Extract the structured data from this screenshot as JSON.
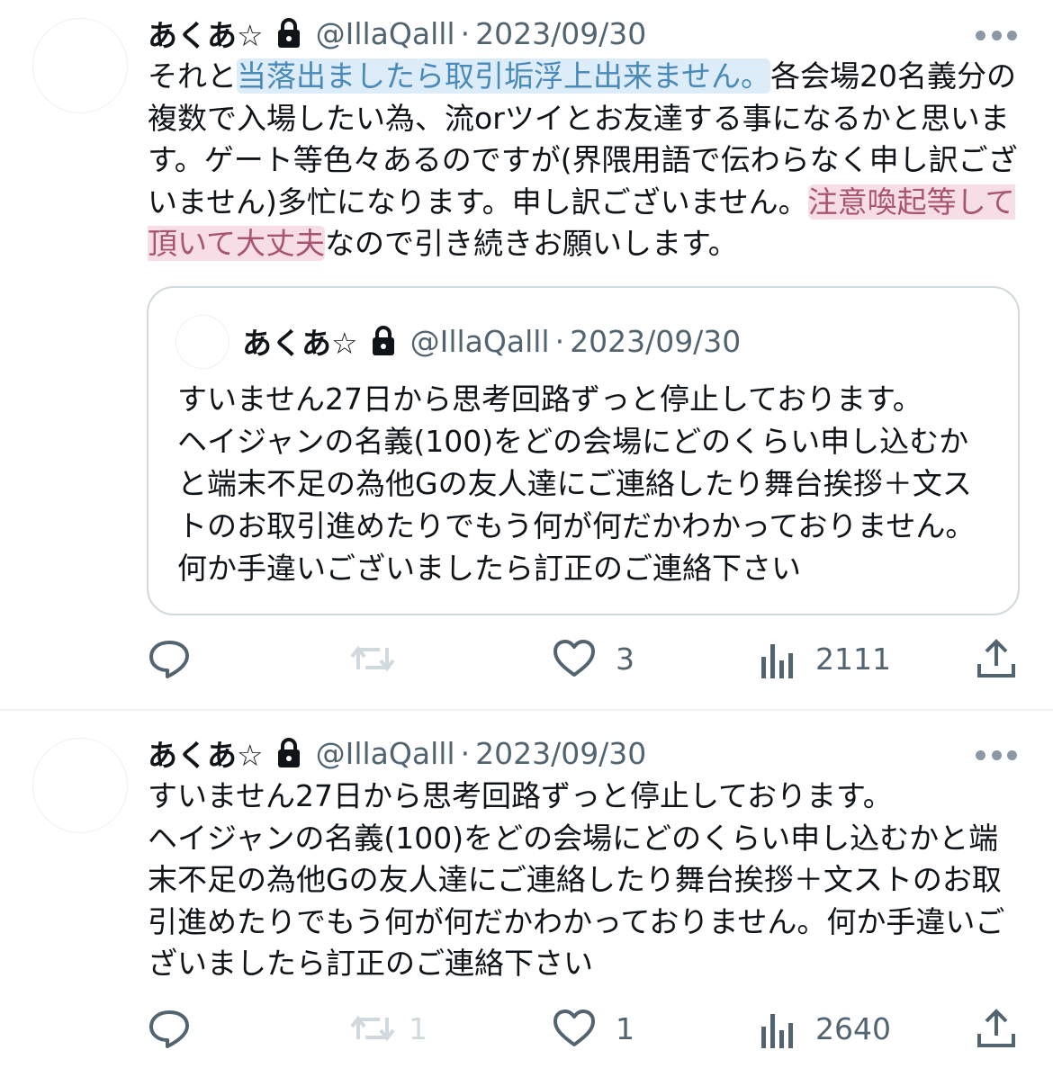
{
  "tweets": [
    {
      "author": {
        "name": "あくあ☆",
        "handle": "@IllaQalll",
        "protected_icon": "lock-icon"
      },
      "separator": "·",
      "date": "2023/09/30",
      "text_parts": [
        {
          "text": "それと"
        },
        {
          "text": "当落出ましたら取引垢浮上出来ません。",
          "highlight": "blue"
        },
        {
          "text": "各会場20名義分の複数で入場したい為、流orツイとお友達する事になるかと思います。ゲート等色々あるのですが(界隈用語で伝わらなく申し訳ございません)多忙になります。申し訳ございません。"
        },
        {
          "text": "注意喚起等して頂いて大丈夫",
          "highlight": "pink"
        },
        {
          "text": "なので引き続きお願いします。"
        }
      ],
      "quote": {
        "author": {
          "name": "あくあ☆",
          "handle": "@IllaQalll"
        },
        "separator": "·",
        "date": "2023/09/30",
        "text": "すいません27日から思考回路ずっと停止しております。\nヘイジャンの名義(100)をどの会場にどのくらい申し込むかと端末不足の為他Gの友人達にご連絡したり舞台挨拶＋文ストのお取引進めたりでもう何が何だかわかっておりません。何か手違いございましたら訂正のご連絡下さい"
      },
      "actions": {
        "replies": "",
        "retweets": "",
        "likes": "3",
        "views": "2111"
      }
    },
    {
      "author": {
        "name": "あくあ☆",
        "handle": "@IllaQalll",
        "protected_icon": "lock-icon"
      },
      "separator": "·",
      "date": "2023/09/30",
      "text": "すいません27日から思考回路ずっと停止しております。\nヘイジャンの名義(100)をどの会場にどのくらい申し込むかと端末不足の為他Gの友人達にご連絡したり舞台挨拶＋文ストのお取引進めたりでもう何が何だかわかっておりません。何か手違いございましたら訂正のご連絡下さい",
      "actions": {
        "replies": "",
        "retweets": "1",
        "likes": "1",
        "views": "2640"
      }
    }
  ],
  "colors": {
    "text": "#0f1419",
    "secondary": "#536471",
    "border": "#cfd9de",
    "highlight_blue": "#dcecf8",
    "highlight_pink": "#f7dde6"
  }
}
